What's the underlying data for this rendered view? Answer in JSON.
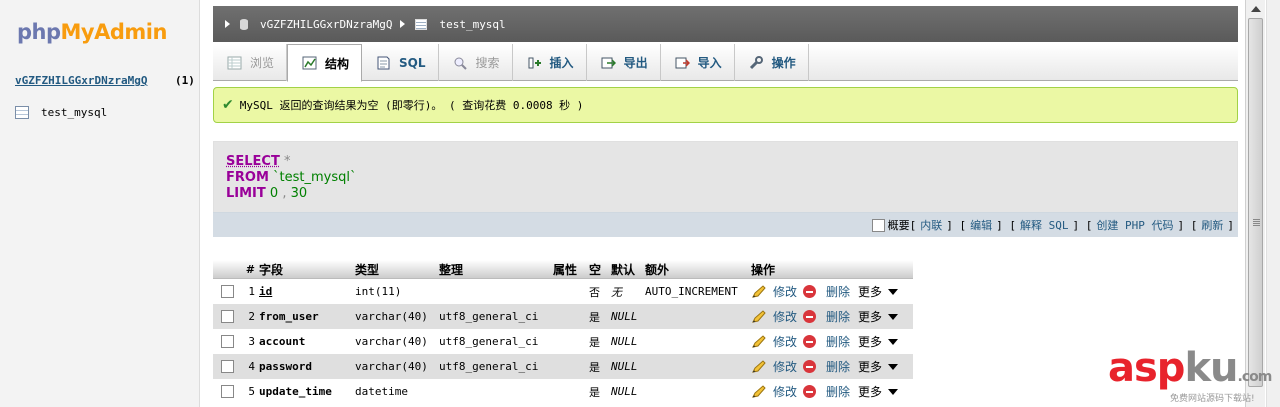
{
  "sidebar": {
    "logo_php": "php",
    "logo_admin": "MyAdmin",
    "db_name": "vGZFZHILGGxrDNzraMgQ",
    "db_count": "(1)",
    "tables": [
      {
        "label": "test_mysql"
      }
    ]
  },
  "breadcrumb": {
    "db": "vGZFZHILGGxrDNzraMgQ",
    "table": "test_mysql"
  },
  "tabs": [
    {
      "label": "浏览",
      "icon": "browse-icon",
      "state": "disabled"
    },
    {
      "label": "结构",
      "icon": "structure-icon",
      "state": "active"
    },
    {
      "label": "SQL",
      "icon": "sql-icon",
      "state": "normal"
    },
    {
      "label": "搜索",
      "icon": "search-icon",
      "state": "disabled"
    },
    {
      "label": "插入",
      "icon": "insert-icon",
      "state": "normal"
    },
    {
      "label": "导出",
      "icon": "export-icon",
      "state": "normal"
    },
    {
      "label": "导入",
      "icon": "import-icon",
      "state": "normal"
    },
    {
      "label": "操作",
      "icon": "wrench-icon",
      "state": "normal"
    }
  ],
  "message": {
    "text": "MySQL 返回的查询结果为空 (即零行)。 ( 查询花费 0.0008 秒 )"
  },
  "sql": {
    "select": "SELECT",
    "star": "*",
    "from": "FROM",
    "table": "`test_mysql`",
    "limit": "LIMIT",
    "offset": "0",
    "comma": ",",
    "count": "30"
  },
  "sql_footer": {
    "profile": "概要",
    "inline": "内联",
    "edit": "编辑",
    "explain": "解释 SQL",
    "create_php": "创建 PHP 代码",
    "refresh": "刷新",
    "open": "[",
    "close": "]"
  },
  "structure": {
    "headers": {
      "num": "#",
      "field": "字段",
      "type": "类型",
      "collation": "整理",
      "attributes": "属性",
      "null": "空",
      "default": "默认",
      "extra": "额外",
      "action": "操作"
    },
    "actions": {
      "edit": "修改",
      "delete": "删除",
      "more": "更多"
    },
    "rows": [
      {
        "num": "1",
        "field": "id",
        "type": "int(11)",
        "collation": "",
        "attributes": "",
        "null": "否",
        "default": "无",
        "extra": "AUTO_INCREMENT"
      },
      {
        "num": "2",
        "field": "from_user",
        "type": "varchar(40)",
        "collation": "utf8_general_ci",
        "attributes": "",
        "null": "是",
        "default": "NULL",
        "extra": ""
      },
      {
        "num": "3",
        "field": "account",
        "type": "varchar(40)",
        "collation": "utf8_general_ci",
        "attributes": "",
        "null": "是",
        "default": "NULL",
        "extra": ""
      },
      {
        "num": "4",
        "field": "password",
        "type": "varchar(40)",
        "collation": "utf8_general_ci",
        "attributes": "",
        "null": "是",
        "default": "NULL",
        "extra": ""
      },
      {
        "num": "5",
        "field": "update_time",
        "type": "datetime",
        "collation": "",
        "attributes": "",
        "null": "是",
        "default": "NULL",
        "extra": ""
      }
    ]
  },
  "watermark": {
    "asp": "asp",
    "ku": "ku",
    "dotcom": ".com",
    "sub": "免费网站源码下载站!"
  },
  "colors": {
    "link": "#235a81",
    "success_bg": "#ebf8a4",
    "keyword": "#990099",
    "string": "#008000"
  }
}
